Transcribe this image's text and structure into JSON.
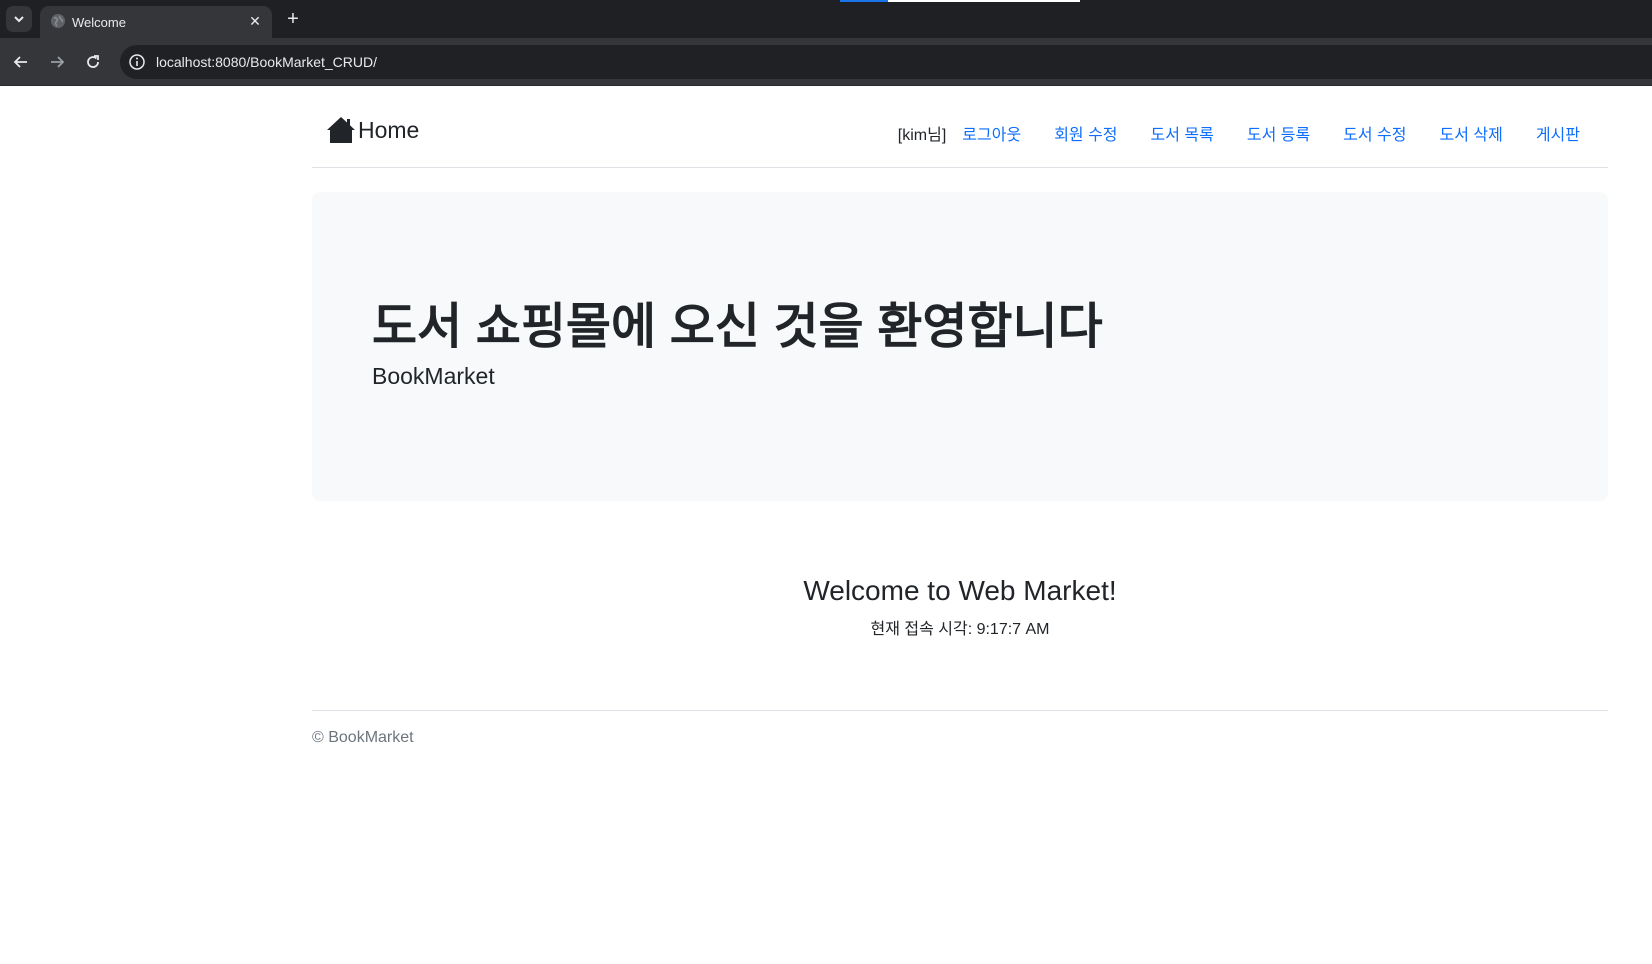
{
  "browser": {
    "tab": {
      "title": "Welcome",
      "close_glyph": "✕",
      "favicon_icon": "globe-icon"
    },
    "new_tab_glyph": "+",
    "menu_glyph": "⌄",
    "url": "localhost:8080/BookMarket_CRUD/",
    "icons": {
      "back": "arrow-left-icon",
      "forward": "arrow-right-icon",
      "reload": "reload-icon",
      "site_info": "info-icon"
    }
  },
  "navbar": {
    "brand_label": "Home",
    "brand_icon": "house-icon",
    "user_greeting": "[kim님]",
    "links": [
      "로그아웃",
      "회원 수정",
      "도서 목록",
      "도서 등록",
      "도서 수정",
      "도서 삭제",
      "게시판"
    ]
  },
  "jumbotron": {
    "title": "도서 쇼핑몰에 오신 것을 환영합니다",
    "subtitle": "BookMarket"
  },
  "welcome": {
    "heading": "Welcome to Web Market!",
    "access_time": "현재 접속 시각: 9:17:7 AM"
  },
  "footer": {
    "text": "© BookMarket"
  },
  "colors": {
    "link": "#0d6efd",
    "text": "#212529",
    "jumbotron_bg": "#f8f9fa",
    "chrome_dark": "#1f2023",
    "chrome_toolbar": "#35363a"
  }
}
